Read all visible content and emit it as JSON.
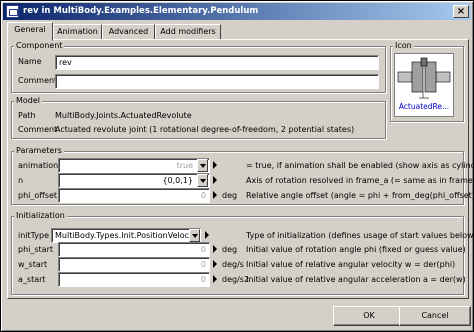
{
  "window": {
    "title": "rev in MultiBody.Examples.Elementary.Pendulum",
    "close_glyph": "×"
  },
  "tabs": [
    "General",
    "Animation",
    "Advanced",
    "Add modifiers"
  ],
  "component": {
    "group_label": "Component",
    "name_label": "Name",
    "name_value": "rev",
    "comment_label": "Comment",
    "comment_value": ""
  },
  "icon": {
    "group_label": "Icon",
    "caption": "ActuatedRe..."
  },
  "model": {
    "group_label": "Model",
    "path_label": "Path",
    "path_value": "MultiBody.Joints.ActuatedRevolute",
    "comment_label": "Comment",
    "comment_value": "Actuated revolute joint (1 rotational degree-of-freedom, 2 potential states)"
  },
  "parameters": {
    "group_label": "Parameters",
    "rows": [
      {
        "name": "animation",
        "value": "true",
        "unit": "",
        "desc": "= true, if animation shall be enabled (show axis as cylinder)"
      },
      {
        "name": "n",
        "value": "{0,0,1}",
        "unit": "",
        "desc": "Axis of rotation resolved in frame_a (= same as in frame_b)"
      },
      {
        "name": "phi_offset",
        "value": "0",
        "unit": "deg",
        "desc": "Relative angle offset (angle = phi + from_deg(phi_offset))"
      }
    ]
  },
  "initialization": {
    "group_label": "Initialization",
    "rows": [
      {
        "name": "initType",
        "value": "MultiBody.Types.Init.PositionVelocity",
        "unit": "",
        "desc": "Type of initialization (defines usage of start values below)"
      },
      {
        "name": "phi_start",
        "value": "0",
        "unit": "deg",
        "desc": "Initial value of rotation angle phi (fixed or guess value)"
      },
      {
        "name": "w_start",
        "value": "0",
        "unit": "deg/s",
        "desc": "Initial value of relative angular velocity w = der(phi)"
      },
      {
        "name": "a_start",
        "value": "0",
        "unit": "deg/s2",
        "desc": "Initial value of relative angular acceleration a = der(w)"
      }
    ]
  },
  "buttons": {
    "ok": "OK",
    "cancel": "Cancel"
  }
}
